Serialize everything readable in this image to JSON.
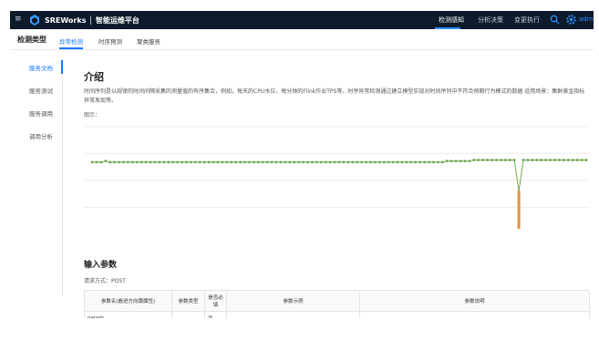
{
  "header": {
    "menu_icon": "hamburger-icon",
    "brand": "SREWorks │ 智能运维平台",
    "nav": [
      {
        "label": "检测感知",
        "active": true
      },
      {
        "label": "分析决策",
        "active": false
      },
      {
        "label": "变更执行",
        "active": false
      }
    ],
    "user": "admin",
    "accent": "#2f8cff"
  },
  "subheader": {
    "title": "检测类型",
    "tabs": [
      {
        "label": "异常检测",
        "active": true
      },
      {
        "label": "时序预测",
        "active": false
      },
      {
        "label": "聚类服务",
        "active": false
      }
    ]
  },
  "sidebar": {
    "items": [
      {
        "label": "服务文档",
        "active": true
      },
      {
        "label": "服务测试",
        "active": false
      },
      {
        "label": "服务调用",
        "active": false
      },
      {
        "label": "调用分析",
        "active": false
      }
    ]
  },
  "main": {
    "intro_title": "介绍",
    "intro_text": "时间序列是以规律的时间间隔采集的测量值的有序集合，例如，每天的CPU水位，每分钟的Flink作业TPS等。时序异常检测通过建立模型实现对时间序列中不符合预期行为模式的数据 适用场景：集群黄金指标异常发现等。",
    "chart_caption": "图示：",
    "params_title": "输入参数",
    "request_method": "请求方式：POST",
    "table": {
      "headers": [
        "参数名(嵌进方向跟属性)",
        "参数类型",
        "是否必填",
        "参数示例",
        "参数说明"
      ],
      "rows": [
        [
          "param",
          "",
          "否",
          "",
          ""
        ]
      ]
    }
  },
  "chart_data": {
    "type": "line",
    "title": "",
    "xlabel": "",
    "ylabel": "",
    "ylim": [
      0,
      1
    ],
    "grid": true,
    "colors": {
      "normal": "#6aa84f",
      "anomaly": "#e69138"
    },
    "series": [
      {
        "values": [
          0.62,
          0.62,
          0.62,
          0.63,
          0.62,
          0.62,
          0.62,
          0.62,
          0.62,
          0.62,
          0.62,
          0.62,
          0.62,
          0.62,
          0.62,
          0.62,
          0.62,
          0.62,
          0.62,
          0.62,
          0.62,
          0.62,
          0.62,
          0.62,
          0.62,
          0.62,
          0.62,
          0.62,
          0.62,
          0.62,
          0.62,
          0.62,
          0.62,
          0.62,
          0.62,
          0.62,
          0.62,
          0.62,
          0.62,
          0.62,
          0.62,
          0.62,
          0.62,
          0.62,
          0.62,
          0.62,
          0.62,
          0.62,
          0.62,
          0.62,
          0.62,
          0.62,
          0.62,
          0.62,
          0.62,
          0.62,
          0.62,
          0.62,
          0.62,
          0.62,
          0.62,
          0.62,
          0.62,
          0.62,
          0.62,
          0.62,
          0.62,
          0.62,
          0.62,
          0.62,
          0.62,
          0.62,
          0.62,
          0.62,
          0.62,
          0.62,
          0.62,
          0.62,
          0.62,
          0.63,
          0.63,
          0.63,
          0.63,
          0.63,
          0.63,
          0.64,
          0.64,
          0.64,
          0.64,
          0.64,
          0.64,
          0.64,
          0.64,
          0.64,
          0.64,
          0.35,
          0.64,
          0.64,
          0.64,
          0.64,
          0.64,
          0.64,
          0.64,
          0.64,
          0.64,
          0.64,
          0.64,
          0.64,
          0.64,
          0.64,
          0.64
        ]
      }
    ],
    "anomaly_index": 95,
    "anomaly_range": [
      0.0,
      0.35
    ]
  }
}
